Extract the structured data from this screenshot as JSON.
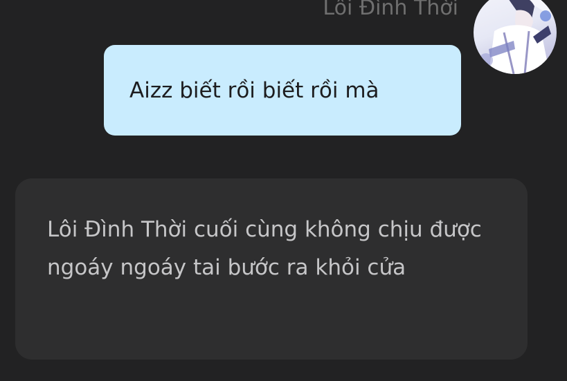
{
  "chat": {
    "sender_name": "Lôi Đình Thời",
    "outgoing_message": "Aizz biết rồi biết rồi mà",
    "narration_message": "Lôi Đình Thời cuối cùng không chịu được ngoáy ngoáy tai bước ra khỏi cửa",
    "avatar_icon": "character-portrait-avatar"
  },
  "colors": {
    "background": "#222223",
    "outgoing_bubble": "#c9ecfe",
    "narration_bubble": "#2e2e2f",
    "narration_text": "#c6c6c8",
    "sender_name_text": "#6f6f6f"
  }
}
